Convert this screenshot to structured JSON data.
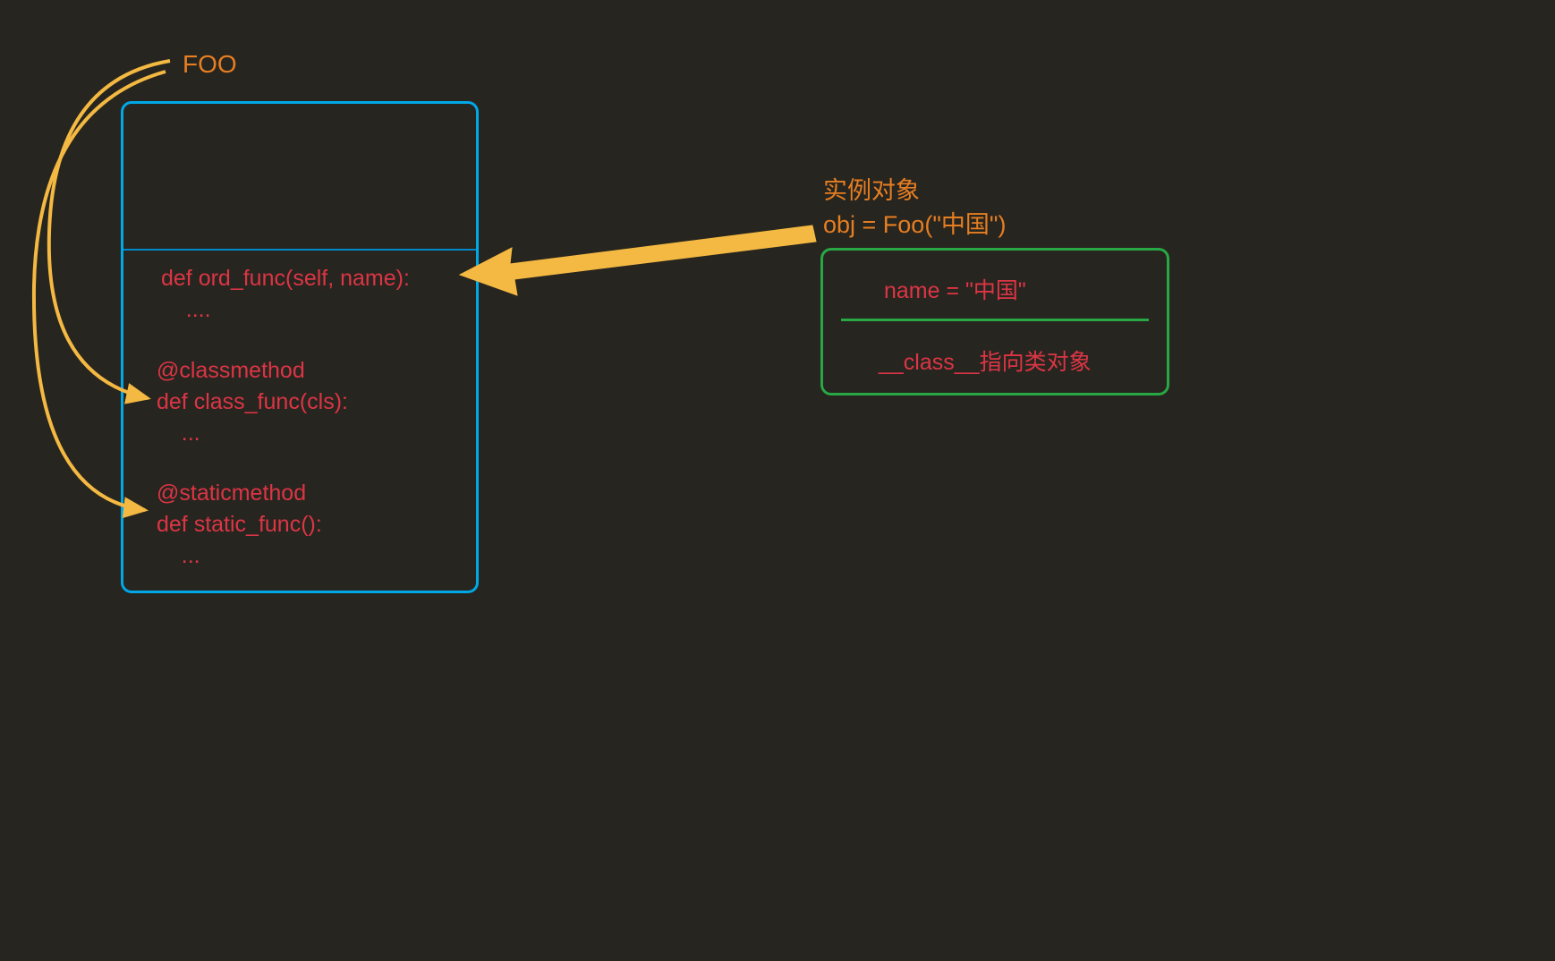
{
  "labels": {
    "foo": "FOO",
    "instance_title": "实例对象\nobj = Foo(\"中国\")"
  },
  "class_box": {
    "method1": "def ord_func(self, name):\n    ....",
    "method2": "@classmethod\ndef class_func(cls):\n    ...",
    "method3": "@staticmethod\ndef static_func():\n    ..."
  },
  "instance_box": {
    "line1": "name = \"中国\"",
    "line2": "__class__指向类对象"
  },
  "colors": {
    "background": "#27251f",
    "class_border": "#00a8e8",
    "instance_border": "#28a745",
    "code_text": "#dc3545",
    "label_text": "#e67e22",
    "arrow": "#f4b942"
  }
}
